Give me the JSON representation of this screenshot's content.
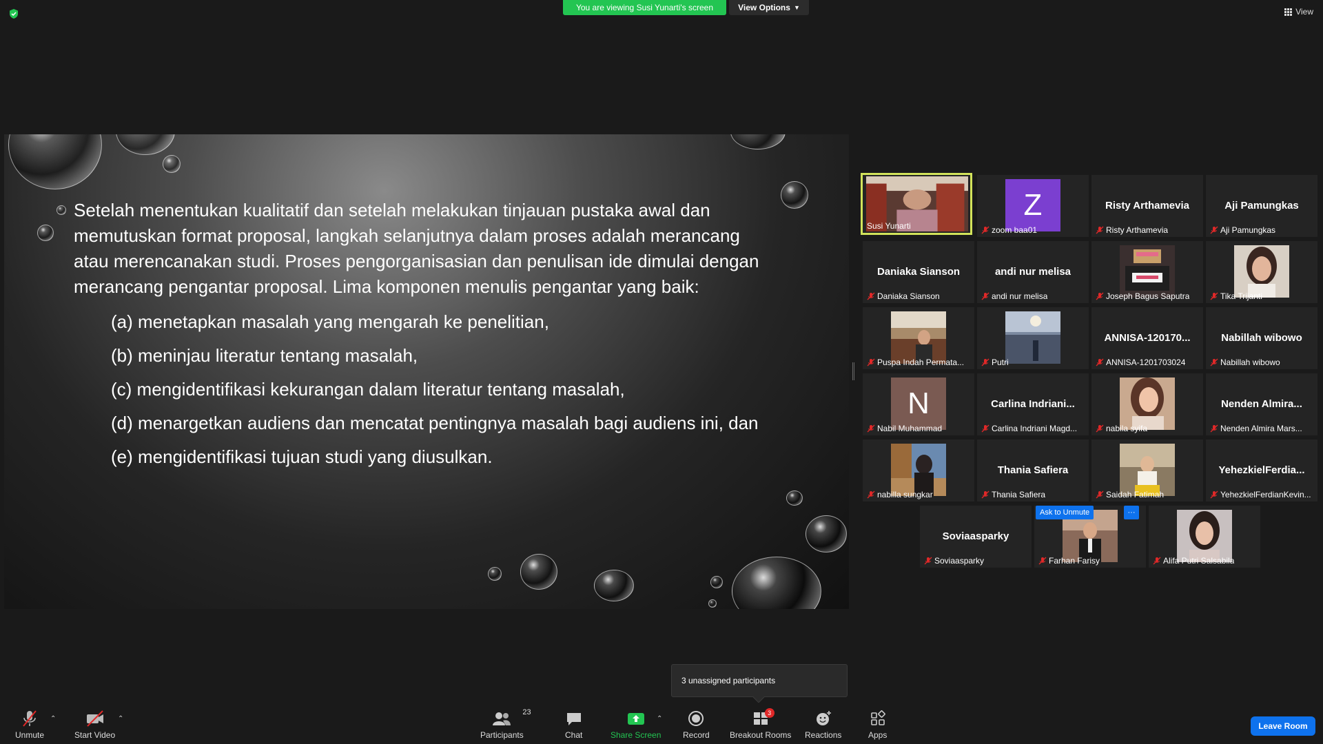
{
  "top": {
    "viewing_banner": "You are viewing Susi Yunarti's screen",
    "view_options": "View Options",
    "view_label": "View"
  },
  "slide": {
    "paragraph": "Setelah menentukan kualitatif dan setelah melakukan tinjauan pustaka awal dan memutuskan format proposal, langkah selanjutnya dalam proses adalah merancang atau merencanakan studi. Proses pengorganisasian dan penulisan ide dimulai dengan merancang pengantar proposal.  Lima komponen menulis pengantar yang baik:",
    "items": [
      "(a) menetapkan masalah yang mengarah ke penelitian,",
      "(b) meninjau literatur tentang masalah,",
      "(c) mengidentifikasi kekurangan dalam literatur tentang masalah,",
      "(d) menargetkan audiens dan mencatat pentingnya masalah bagi audiens ini, dan",
      "(e) mengidentifikasi tujuan studi yang diusulkan."
    ]
  },
  "participants": [
    {
      "label": "Susi Yunarti",
      "kind": "video",
      "muted": false
    },
    {
      "label": "zoom baa01",
      "kind": "avatar",
      "letter": "Z",
      "avatar_color": "#7b3fd0",
      "muted": true
    },
    {
      "name": "Risty Arthamevia",
      "label": "Risty Arthamevia",
      "kind": "name",
      "muted": true
    },
    {
      "name": "Aji Pamungkas",
      "label": "Aji Pamungkas",
      "kind": "name",
      "muted": true
    },
    {
      "name": "Daniaka Sianson",
      "label": "Daniaka Sianson",
      "kind": "name",
      "muted": true
    },
    {
      "name": "andi nur melisa",
      "label": "andi nur melisa",
      "kind": "name",
      "muted": true
    },
    {
      "label": "Joseph Bagus Saputra",
      "kind": "video",
      "muted": true
    },
    {
      "label": "Tika Trijanti",
      "kind": "video",
      "muted": true
    },
    {
      "label": "Puspa Indah Permata...",
      "kind": "video",
      "muted": true
    },
    {
      "label": "Putri",
      "kind": "video",
      "muted": true
    },
    {
      "name": "ANNISA-120170...",
      "label": "ANNISA-1201703024",
      "kind": "name",
      "muted": true
    },
    {
      "name": "Nabillah wibowo",
      "label": "Nabillah wibowo",
      "kind": "name",
      "muted": true
    },
    {
      "label": "Nabil Muhammad",
      "kind": "avatar",
      "letter": "N",
      "avatar_color": "#7a5a52",
      "muted": true
    },
    {
      "name": "Carlina  Indriani...",
      "label": "Carlina Indriani Magd...",
      "kind": "name",
      "muted": true
    },
    {
      "label": "nabila syifa",
      "kind": "video",
      "muted": true
    },
    {
      "name": "Nenden  Almira...",
      "label": "Nenden Almira Mars...",
      "kind": "name",
      "muted": true
    },
    {
      "label": "nabilla sungkar",
      "kind": "video",
      "muted": true
    },
    {
      "name": "Thania Safiera",
      "label": "Thania Safiera",
      "kind": "name",
      "muted": true
    },
    {
      "label": "Saidah Fatimah",
      "kind": "video",
      "muted": true
    },
    {
      "name": "YehezkielFerdia...",
      "label": "YehezkielFerdianKevin...",
      "kind": "name",
      "muted": true
    },
    {
      "name": "Soviaasparky",
      "label": "Soviaasparky",
      "kind": "name",
      "muted": true
    },
    {
      "label": "Farhan Farisy",
      "kind": "video",
      "muted": true,
      "ask_unmute": "Ask to Unmute",
      "more": "···"
    },
    {
      "label": "Alifa Putri Salsabila",
      "kind": "video",
      "muted": true
    }
  ],
  "popup": {
    "text": "3 unassigned participants"
  },
  "toolbar": {
    "unmute": "Unmute",
    "start_video": "Start Video",
    "participants": "Participants",
    "participants_count": "23",
    "chat": "Chat",
    "share_screen": "Share Screen",
    "record": "Record",
    "breakout_rooms": "Breakout Rooms",
    "breakout_badge": "3",
    "reactions": "Reactions",
    "apps": "Apps",
    "leave": "Leave Room"
  },
  "colors": {
    "banner_green": "#23c552",
    "accent_blue": "#0e72ed",
    "active_speaker": "#d2e35a",
    "share_green": "#23c552",
    "muted_red": "#e02828"
  }
}
